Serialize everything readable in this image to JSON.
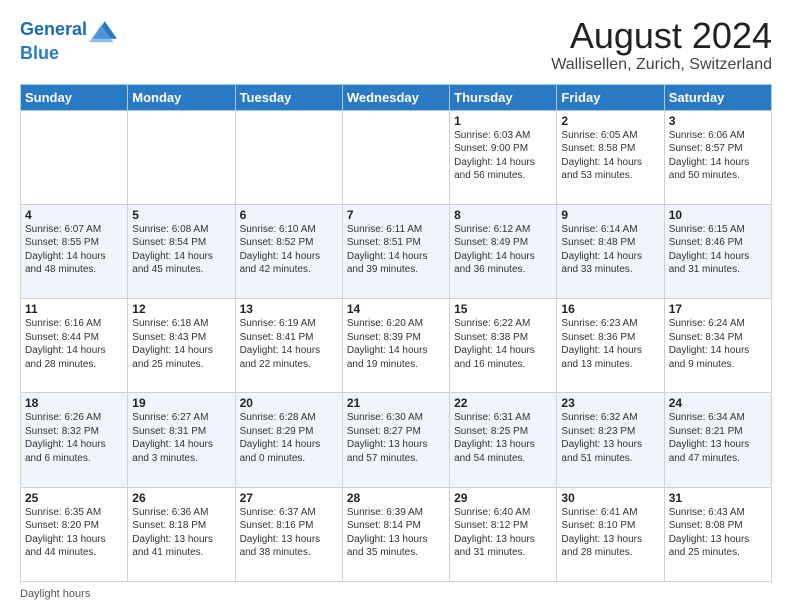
{
  "header": {
    "logo_line1": "General",
    "logo_line2": "Blue",
    "title": "August 2024",
    "subtitle": "Wallisellen, Zurich, Switzerland"
  },
  "days_of_week": [
    "Sunday",
    "Monday",
    "Tuesday",
    "Wednesday",
    "Thursday",
    "Friday",
    "Saturday"
  ],
  "weeks": [
    [
      {
        "day": "",
        "info": ""
      },
      {
        "day": "",
        "info": ""
      },
      {
        "day": "",
        "info": ""
      },
      {
        "day": "",
        "info": ""
      },
      {
        "day": "1",
        "info": "Sunrise: 6:03 AM\nSunset: 9:00 PM\nDaylight: 14 hours\nand 56 minutes."
      },
      {
        "day": "2",
        "info": "Sunrise: 6:05 AM\nSunset: 8:58 PM\nDaylight: 14 hours\nand 53 minutes."
      },
      {
        "day": "3",
        "info": "Sunrise: 6:06 AM\nSunset: 8:57 PM\nDaylight: 14 hours\nand 50 minutes."
      }
    ],
    [
      {
        "day": "4",
        "info": "Sunrise: 6:07 AM\nSunset: 8:55 PM\nDaylight: 14 hours\nand 48 minutes."
      },
      {
        "day": "5",
        "info": "Sunrise: 6:08 AM\nSunset: 8:54 PM\nDaylight: 14 hours\nand 45 minutes."
      },
      {
        "day": "6",
        "info": "Sunrise: 6:10 AM\nSunset: 8:52 PM\nDaylight: 14 hours\nand 42 minutes."
      },
      {
        "day": "7",
        "info": "Sunrise: 6:11 AM\nSunset: 8:51 PM\nDaylight: 14 hours\nand 39 minutes."
      },
      {
        "day": "8",
        "info": "Sunrise: 6:12 AM\nSunset: 8:49 PM\nDaylight: 14 hours\nand 36 minutes."
      },
      {
        "day": "9",
        "info": "Sunrise: 6:14 AM\nSunset: 8:48 PM\nDaylight: 14 hours\nand 33 minutes."
      },
      {
        "day": "10",
        "info": "Sunrise: 6:15 AM\nSunset: 8:46 PM\nDaylight: 14 hours\nand 31 minutes."
      }
    ],
    [
      {
        "day": "11",
        "info": "Sunrise: 6:16 AM\nSunset: 8:44 PM\nDaylight: 14 hours\nand 28 minutes."
      },
      {
        "day": "12",
        "info": "Sunrise: 6:18 AM\nSunset: 8:43 PM\nDaylight: 14 hours\nand 25 minutes."
      },
      {
        "day": "13",
        "info": "Sunrise: 6:19 AM\nSunset: 8:41 PM\nDaylight: 14 hours\nand 22 minutes."
      },
      {
        "day": "14",
        "info": "Sunrise: 6:20 AM\nSunset: 8:39 PM\nDaylight: 14 hours\nand 19 minutes."
      },
      {
        "day": "15",
        "info": "Sunrise: 6:22 AM\nSunset: 8:38 PM\nDaylight: 14 hours\nand 16 minutes."
      },
      {
        "day": "16",
        "info": "Sunrise: 6:23 AM\nSunset: 8:36 PM\nDaylight: 14 hours\nand 13 minutes."
      },
      {
        "day": "17",
        "info": "Sunrise: 6:24 AM\nSunset: 8:34 PM\nDaylight: 14 hours\nand 9 minutes."
      }
    ],
    [
      {
        "day": "18",
        "info": "Sunrise: 6:26 AM\nSunset: 8:32 PM\nDaylight: 14 hours\nand 6 minutes."
      },
      {
        "day": "19",
        "info": "Sunrise: 6:27 AM\nSunset: 8:31 PM\nDaylight: 14 hours\nand 3 minutes."
      },
      {
        "day": "20",
        "info": "Sunrise: 6:28 AM\nSunset: 8:29 PM\nDaylight: 14 hours\nand 0 minutes."
      },
      {
        "day": "21",
        "info": "Sunrise: 6:30 AM\nSunset: 8:27 PM\nDaylight: 13 hours\nand 57 minutes."
      },
      {
        "day": "22",
        "info": "Sunrise: 6:31 AM\nSunset: 8:25 PM\nDaylight: 13 hours\nand 54 minutes."
      },
      {
        "day": "23",
        "info": "Sunrise: 6:32 AM\nSunset: 8:23 PM\nDaylight: 13 hours\nand 51 minutes."
      },
      {
        "day": "24",
        "info": "Sunrise: 6:34 AM\nSunset: 8:21 PM\nDaylight: 13 hours\nand 47 minutes."
      }
    ],
    [
      {
        "day": "25",
        "info": "Sunrise: 6:35 AM\nSunset: 8:20 PM\nDaylight: 13 hours\nand 44 minutes."
      },
      {
        "day": "26",
        "info": "Sunrise: 6:36 AM\nSunset: 8:18 PM\nDaylight: 13 hours\nand 41 minutes."
      },
      {
        "day": "27",
        "info": "Sunrise: 6:37 AM\nSunset: 8:16 PM\nDaylight: 13 hours\nand 38 minutes."
      },
      {
        "day": "28",
        "info": "Sunrise: 6:39 AM\nSunset: 8:14 PM\nDaylight: 13 hours\nand 35 minutes."
      },
      {
        "day": "29",
        "info": "Sunrise: 6:40 AM\nSunset: 8:12 PM\nDaylight: 13 hours\nand 31 minutes."
      },
      {
        "day": "30",
        "info": "Sunrise: 6:41 AM\nSunset: 8:10 PM\nDaylight: 13 hours\nand 28 minutes."
      },
      {
        "day": "31",
        "info": "Sunrise: 6:43 AM\nSunset: 8:08 PM\nDaylight: 13 hours\nand 25 minutes."
      }
    ]
  ],
  "footer": {
    "daylight_label": "Daylight hours"
  }
}
